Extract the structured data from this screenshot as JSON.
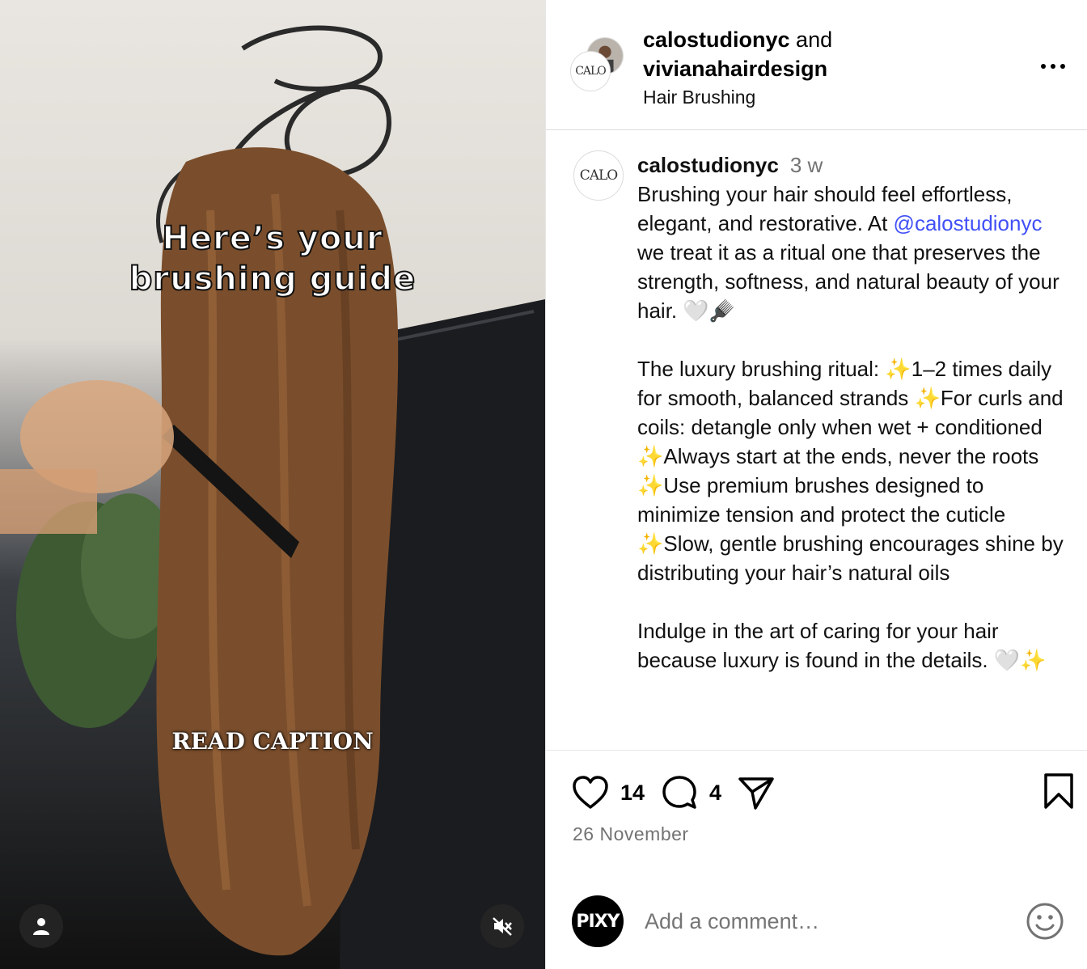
{
  "media": {
    "headline_line1": "Here’s your",
    "headline_line2": "brushing guide",
    "overlay_text": "READ CAPTION"
  },
  "header": {
    "user1": "calostudionyc",
    "joiner": " and",
    "user2": "vivianahairdesign",
    "audio": "Hair Brushing",
    "avatar_logo": "CALO"
  },
  "caption": {
    "username": "calostudionyc",
    "time": "3 w",
    "line1": "Brushing your hair should feel effortless, elegant, and restorative. At ",
    "mention": "@calostudionyc",
    "line2": " we treat it as a ritual one that preserves the strength, softness, and natural beauty of your hair. 🤍🪮\n\nThe luxury brushing ritual: ✨1–2 times daily for smooth, balanced strands ✨For curls and coils: detangle only when wet + conditioned ✨Always start at the ends, never the roots ✨Use premium brushes designed to minimize tension and protect the cuticle ✨Slow, gentle brushing encourages shine by distributing your hair’s natural oils\n\nIndulge in the art of caring for your hair because luxury is found in the details. 🤍✨"
  },
  "actions": {
    "likes": "14",
    "comments": "4"
  },
  "date": "26 November",
  "comment_box": {
    "avatar_text": "PIXY",
    "placeholder": "Add a comment…"
  }
}
